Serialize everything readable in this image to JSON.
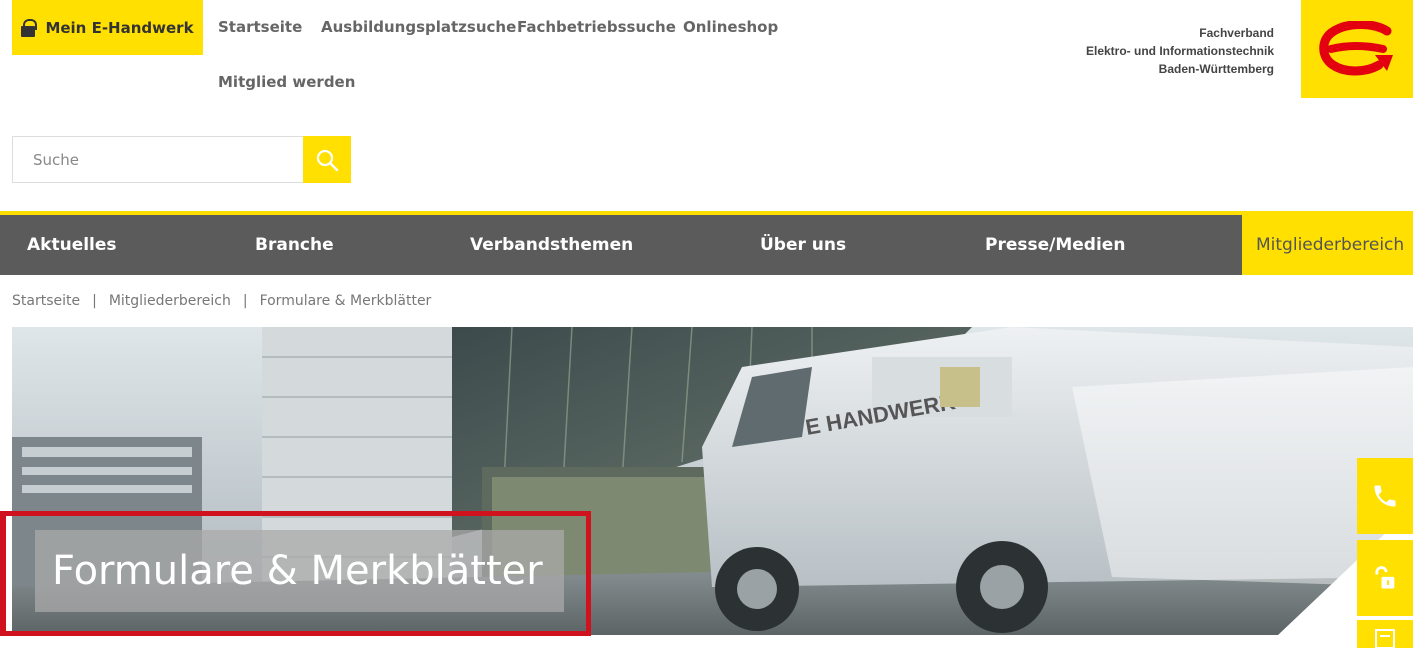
{
  "top": {
    "mein_label": "Mein E-Handwerk",
    "nav": [
      "Startseite",
      "Ausbildungsplatzsuche",
      "Fachbetriebssuche",
      "Onlineshop",
      "Mitglied werden"
    ]
  },
  "org": {
    "line1": "Fachverband",
    "line2": "Elektro- und Informationstechnik",
    "line3": "Baden-Württemberg"
  },
  "search": {
    "placeholder": "Suche"
  },
  "mainnav": [
    "Aktuelles",
    "Branche",
    "Verbandsthemen",
    "Über uns",
    "Presse/Medien",
    "Mitgliederbereich"
  ],
  "breadcrumb": [
    "Startseite",
    "Mitgliederbereich",
    "Formulare & Merkblätter"
  ],
  "hero": {
    "title": "Formulare & Merkblätter",
    "van_brand": "E HANDWERK"
  },
  "colors": {
    "accent": "#ffe000",
    "nav_bg": "#5b5b5b",
    "highlight": "#d0121e",
    "logo_red": "#e3000f"
  },
  "icons": [
    "lock-icon",
    "search-icon",
    "phone-icon",
    "unlock-icon",
    "document-icon"
  ]
}
